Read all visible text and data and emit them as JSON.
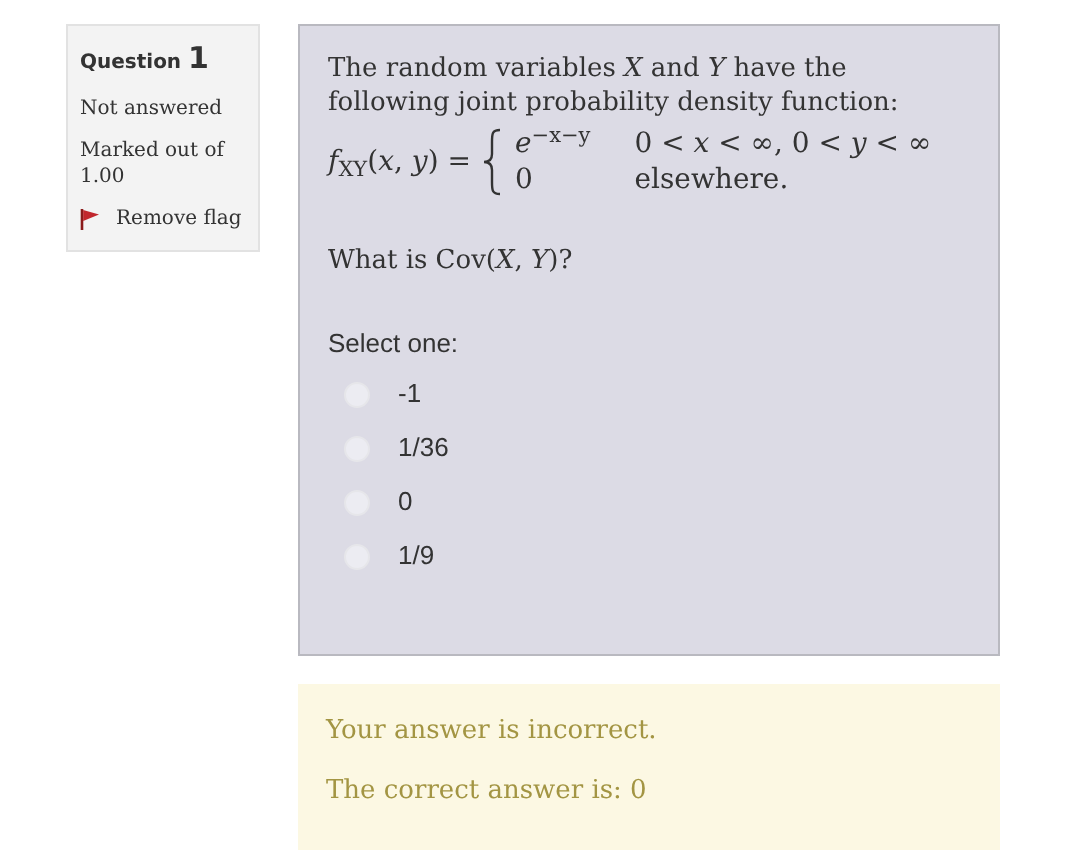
{
  "question_info": {
    "label": "Question",
    "number": "1",
    "state": "Not answered",
    "marks": "Marked out of 1.00",
    "flag_action": "Remove flag"
  },
  "question": {
    "intro": "The random variables *X* and *Y* have the following joint probability density function:",
    "formula": {
      "lhs": "*f*$_{XY}$(*x*, *y*) =",
      "cases": [
        {
          "expr": "*e*$^{−x−y}$",
          "condition": "0 < *x* < ∞, 0 < *y* < ∞"
        },
        {
          "expr": "0",
          "condition": "elsewhere."
        }
      ]
    },
    "prompt": "What is Cov(*X*, *Y*)?",
    "select_label": "Select one:",
    "options": [
      {
        "label": "-1",
        "selected": false
      },
      {
        "label": "1/36",
        "selected": false
      },
      {
        "label": "0",
        "selected": false
      },
      {
        "label": "1/9",
        "selected": false
      }
    ]
  },
  "feedback": {
    "verdict": "Your answer is incorrect.",
    "correct_answer": "The correct answer is: 0"
  }
}
